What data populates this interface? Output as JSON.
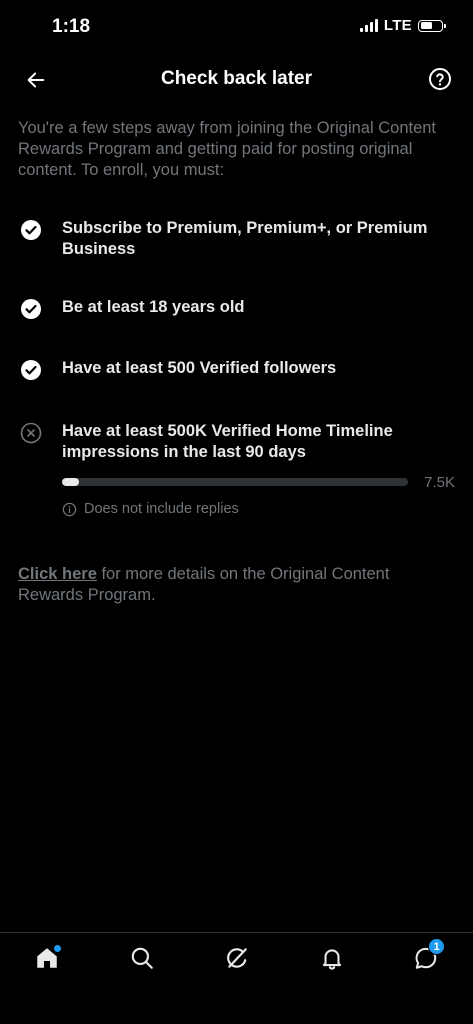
{
  "status_bar": {
    "time": "1:18",
    "network": "LTE",
    "battery_level": 0.62
  },
  "header": {
    "title": "Check back later",
    "back_icon": "arrow-left-icon",
    "help_icon": "question-circle-icon"
  },
  "intro": "You're a few steps away from joining the Original Content Rewards Program and getting paid for posting original content. To enroll, you must:",
  "requirements": [
    {
      "text": "Subscribe to Premium, Premium+, or Premium Business",
      "met": true
    },
    {
      "text": "Be at least 18 years old",
      "met": true
    },
    {
      "text": "Have at least 500 Verified followers",
      "met": true
    },
    {
      "text": "Have at least 500K Verified Home Timeline impressions in the last 90 days",
      "met": false
    }
  ],
  "progress": {
    "value_label": "7.5K",
    "fraction": 0.015,
    "note": "Does not include replies"
  },
  "footer": {
    "link_text": "Click here",
    "rest_text": " for more details on the Original Content Rewards Program."
  },
  "tabbar": {
    "tabs": [
      "home-icon",
      "search-icon",
      "grok-icon",
      "bell-icon",
      "messages-icon"
    ],
    "messages_badge": "1"
  },
  "colors": {
    "background": "#000000",
    "text_primary": "#e7e9ea",
    "text_secondary": "#71767b",
    "accent": "#1d9bf0"
  }
}
